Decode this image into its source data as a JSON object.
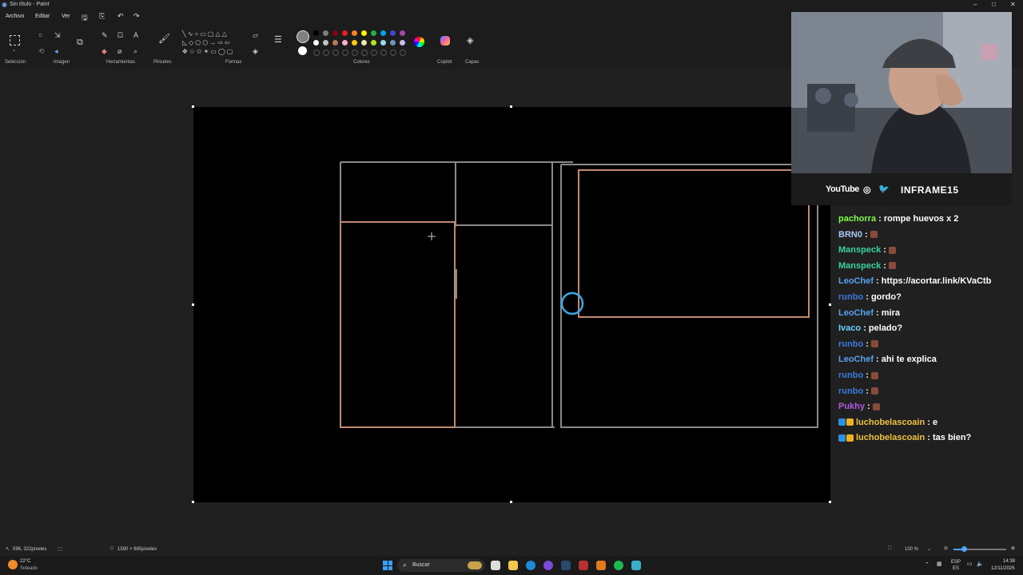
{
  "window": {
    "title": "Sin título - Paint",
    "controls": [
      "–",
      "□",
      "✕"
    ]
  },
  "menu": {
    "items": [
      "Archivo",
      "Editar",
      "Ver"
    ]
  },
  "ribbon": {
    "groups": [
      "Selección",
      "Imagen",
      "Herramientas",
      "Pinceles",
      "Formas",
      "Colores",
      "Copilot",
      "Capas"
    ]
  },
  "palette": {
    "row1": [
      "#000000",
      "#7f7f7f",
      "#880015",
      "#ed1c24",
      "#ff7f27",
      "#fff200",
      "#22b14c",
      "#00a2e8",
      "#3f48cc",
      "#a349a4"
    ],
    "row2": [
      "#ffffff",
      "#c3c3c3",
      "#b97a57",
      "#ffaec9",
      "#ffc90e",
      "#efe4b0",
      "#b5e61d",
      "#99d9ea",
      "#7092be",
      "#c8bfe7"
    ],
    "primary": "#808080",
    "secondary": "#ffffff"
  },
  "status": {
    "cursor_pos": "596, 322píxeles",
    "canvas_size": "1590 × 985píxeles",
    "zoom": "100 %"
  },
  "taskbar": {
    "weather_temp": "22°C",
    "weather_desc": "Soleado",
    "search_label": "Buscar",
    "lang_top": "ESP",
    "lang_bottom": "ES",
    "time": "14:38",
    "date": "12/11/2025"
  },
  "stream": {
    "youtube_label": "YouTube",
    "channel": "INFRAME15"
  },
  "chat": {
    "messages": [
      {
        "user": "pachorra",
        "color": "#7cfc4a",
        "text": "rompe huevos x 2",
        "emote": false,
        "badges": false
      },
      {
        "user": "BRN0",
        "color": "#a8c8f0",
        "text": "",
        "emote": true,
        "badges": false
      },
      {
        "user": "Manspeck",
        "color": "#3ad3a0",
        "text": "",
        "emote": true,
        "badges": false
      },
      {
        "user": "Manspeck",
        "color": "#3ad3a0",
        "text": "",
        "emote": true,
        "badges": false
      },
      {
        "user": "LeoChef",
        "color": "#5aa0f0",
        "text": "https://acortar.link/KVaCtb",
        "emote": false,
        "badges": false
      },
      {
        "user": "runbo",
        "color": "#3a7ae0",
        "text": "gordo?",
        "emote": false,
        "badges": false
      },
      {
        "user": "LeoChef",
        "color": "#5aa0f0",
        "text": "mira",
        "emote": false,
        "badges": false
      },
      {
        "user": "Ivaco",
        "color": "#6ad0ff",
        "text": "pelado?",
        "emote": false,
        "badges": false
      },
      {
        "user": "runbo",
        "color": "#3a7ae0",
        "text": "",
        "emote": true,
        "badges": false
      },
      {
        "user": "LeoChef",
        "color": "#5aa0f0",
        "text": "ahi te explica",
        "emote": false,
        "badges": false
      },
      {
        "user": "runbo",
        "color": "#3a7ae0",
        "text": "",
        "emote": true,
        "badges": false
      },
      {
        "user": "runbo",
        "color": "#3a7ae0",
        "text": "",
        "emote": true,
        "badges": false
      },
      {
        "user": "Pukhy",
        "color": "#b05ae0",
        "text": "",
        "emote": true,
        "badges": false
      },
      {
        "user": "luchobelascoain",
        "color": "#f0c040",
        "text": "e",
        "emote": false,
        "badges": true
      },
      {
        "user": "luchobelascoain",
        "color": "#f0c040",
        "text": "tas bien?",
        "emote": false,
        "badges": true
      }
    ]
  }
}
